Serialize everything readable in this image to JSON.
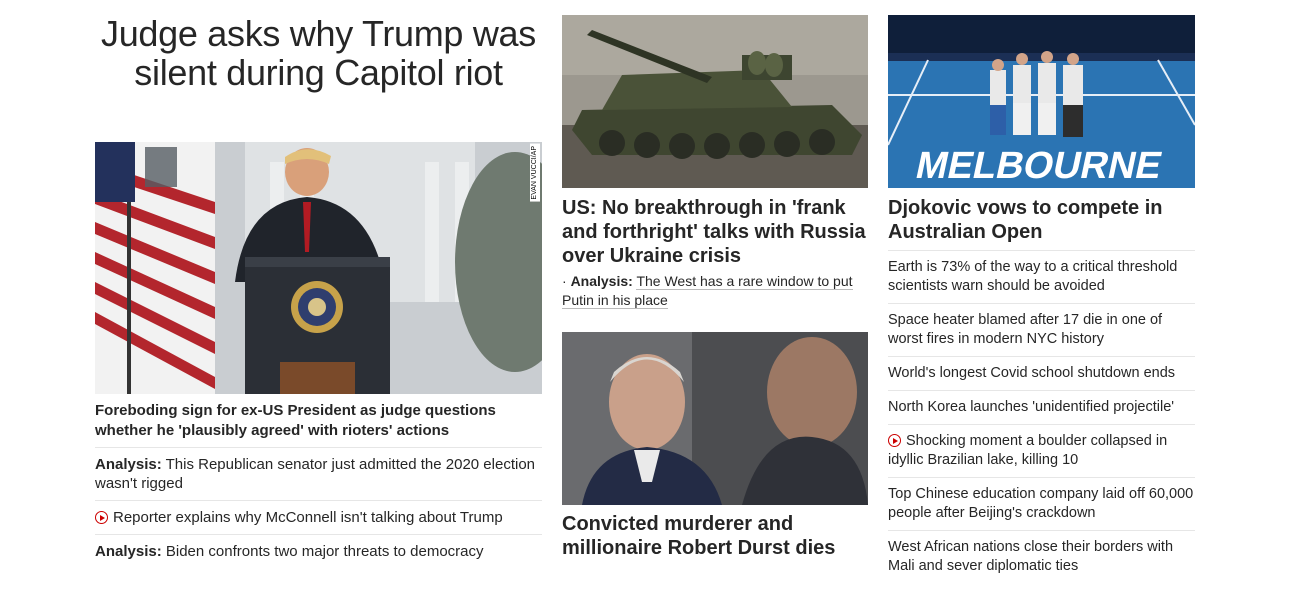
{
  "lead": {
    "title": "Judge asks why Trump was silent during Capitol riot",
    "image_credit": "EVAN VUCCI/AP",
    "caption": "Foreboding sign for ex-US President as judge questions whether he 'plausibly agreed' with rioters' actions",
    "items": [
      {
        "prefix": "Analysis:",
        "text": "This Republican senator just admitted the 2020 election wasn't rigged",
        "video": false
      },
      {
        "prefix": "",
        "text": "Reporter explains why McConnell isn't talking about Trump",
        "video": true
      },
      {
        "prefix": "Analysis:",
        "text": "Biden confronts two major threats to democracy",
        "video": false
      }
    ]
  },
  "middle": {
    "headline": "US: No breakthrough in 'frank and forthright' talks with Russia over Ukraine crisis",
    "analysis_prefix": "Analysis:",
    "analysis_text": "The West has a rare window to put Putin in his place",
    "headline2": "Convicted murderer and millionaire Robert Durst dies"
  },
  "right": {
    "image_text": "MELBOURNE",
    "headline": "Djokovic vows to compete in Australian Open",
    "items": [
      {
        "text": "Earth is 73% of the way to a critical threshold scientists warn should be avoided",
        "video": false
      },
      {
        "text": "Space heater blamed after 17 die in one of worst fires in modern NYC history",
        "video": false
      },
      {
        "text": "World's longest Covid school shutdown ends",
        "video": false
      },
      {
        "text": "North Korea launches 'unidentified projectile'",
        "video": false
      },
      {
        "text": "Shocking moment a boulder collapsed in idyllic Brazilian lake, killing 10",
        "video": true
      },
      {
        "text": "Top Chinese education company laid off 60,000 people after Beijing's crackdown",
        "video": false
      },
      {
        "text": "West African nations close their borders with Mali and sever diplomatic ties",
        "video": false
      }
    ]
  },
  "colors": {
    "text": "#262626",
    "divider": "#e6e6e6",
    "video_icon": "#cc0000"
  }
}
